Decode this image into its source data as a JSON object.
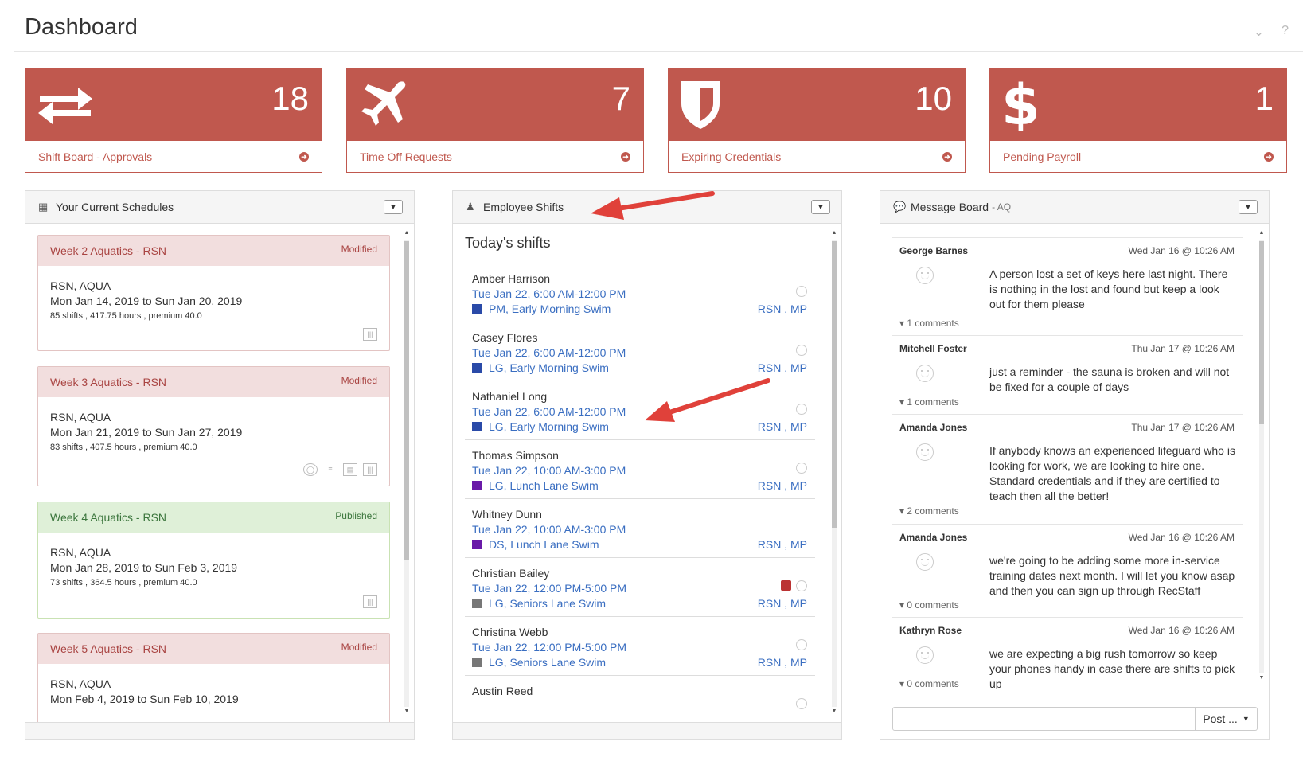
{
  "page": {
    "title": "Dashboard"
  },
  "tiles": [
    {
      "count": "18",
      "label": "Shift Board - Approvals",
      "icon": "swap-arrows-icon"
    },
    {
      "count": "7",
      "label": "Time Off Requests",
      "icon": "plane-icon"
    },
    {
      "count": "10",
      "label": "Expiring Credentials",
      "icon": "shield-icon"
    },
    {
      "count": "1",
      "label": "Pending Payroll",
      "icon": "dollar-icon"
    }
  ],
  "schedules_panel": {
    "title": "Your Current Schedules",
    "items": [
      {
        "title": "Week 2 Aquatics - RSN",
        "status": "Modified",
        "location": "RSN, AQUA",
        "dates": "Mon Jan 14, 2019 to Sun Jan 20, 2019",
        "stats": "85 shifts , 417.75 hours , premium 40.0"
      },
      {
        "title": "Week 3 Aquatics - RSN",
        "status": "Modified",
        "location": "RSN, AQUA",
        "dates": "Mon Jan 21, 2019 to Sun Jan 27, 2019",
        "stats": "83 shifts , 407.5 hours , premium 40.0"
      },
      {
        "title": "Week 4 Aquatics - RSN",
        "status": "Published",
        "location": "RSN, AQUA",
        "dates": "Mon Jan 28, 2019 to Sun Feb 3, 2019",
        "stats": "73 shifts , 364.5 hours , premium 40.0"
      },
      {
        "title": "Week 5 Aquatics - RSN",
        "status": "Modified",
        "location": "RSN, AQUA",
        "dates": "Mon Feb 4, 2019 to Sun Feb 10, 2019",
        "stats": ""
      }
    ]
  },
  "shifts_panel": {
    "title": "Employee Shifts",
    "subtitle": "Today's shifts",
    "shifts": [
      {
        "name": "Amber Harrison",
        "time": "Tue Jan 22, 6:00 AM-12:00 PM",
        "role": "PM, Early Morning Swim",
        "loc": "RSN , MP",
        "color": "#2a4aa8"
      },
      {
        "name": "Casey Flores",
        "time": "Tue Jan 22, 6:00 AM-12:00 PM",
        "role": "LG, Early Morning Swim",
        "loc": "RSN , MP",
        "color": "#2a4aa8"
      },
      {
        "name": "Nathaniel Long",
        "time": "Tue Jan 22, 6:00 AM-12:00 PM",
        "role": "LG, Early Morning Swim",
        "loc": "RSN , MP",
        "color": "#2a4aa8"
      },
      {
        "name": "Thomas Simpson",
        "time": "Tue Jan 22, 10:00 AM-3:00 PM",
        "role": "LG, Lunch Lane Swim",
        "loc": "RSN , MP",
        "color": "#6a1aa8"
      },
      {
        "name": "Whitney Dunn",
        "time": "Tue Jan 22, 10:00 AM-3:00 PM",
        "role": "DS, Lunch Lane Swim",
        "loc": "RSN , MP",
        "color": "#6a1aa8"
      },
      {
        "name": "Christian Bailey",
        "time": "Tue Jan 22, 12:00 PM-5:00 PM",
        "role": "LG, Seniors Lane Swim",
        "loc": "RSN , MP",
        "color": "#777777"
      },
      {
        "name": "Christina Webb",
        "time": "Tue Jan 22, 12:00 PM-5:00 PM",
        "role": "LG, Seniors Lane Swim",
        "loc": "RSN , MP",
        "color": "#777777"
      },
      {
        "name": "Austin Reed",
        "time": "",
        "role": "",
        "loc": "",
        "color": "#777777"
      }
    ]
  },
  "messages_panel": {
    "title": "Message Board",
    "sub": "- AQ",
    "post_label": "Post ...",
    "messages": [
      {
        "author": "George Barnes",
        "date": "Wed Jan 16 @ 10:26 AM",
        "text": "A person lost a set of keys here last night. There is nothing in the lost and found but keep a look out for them please",
        "comments": "1 comments"
      },
      {
        "author": "Mitchell Foster",
        "date": "Thu Jan 17 @ 10:26 AM",
        "text": "just a reminder - the sauna is broken and will not be fixed for a couple of days",
        "comments": "1 comments"
      },
      {
        "author": "Amanda Jones",
        "date": "Thu Jan 17 @ 10:26 AM",
        "text": "If anybody knows an experienced lifeguard who is looking for work, we are looking to hire one. Standard credentials and if they are certified to teach then all the better!",
        "comments": "2 comments"
      },
      {
        "author": "Amanda Jones",
        "date": "Wed Jan 16 @ 10:26 AM",
        "text": "we're going to be adding some more in-service training dates next month. I will let you know asap and then you can sign up through RecStaff",
        "comments": "0 comments"
      },
      {
        "author": "Kathryn Rose",
        "date": "Wed Jan 16 @ 10:26 AM",
        "text": "we are expecting a big rush tomorrow so keep your phones handy in case there are shifts to pick up",
        "comments": "0 comments"
      }
    ]
  },
  "colors": {
    "tile": "#c0584e",
    "link": "#3a6ec1",
    "annotation_arrow": "#e0413a"
  }
}
